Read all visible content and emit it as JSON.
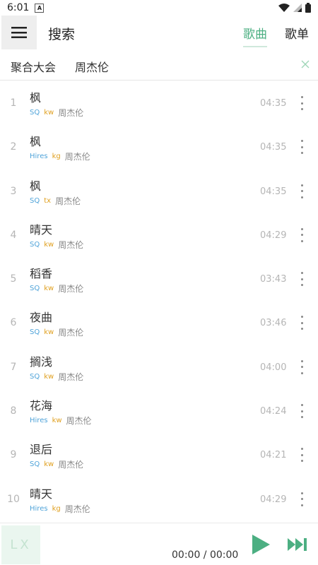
{
  "status_bar": {
    "time": "6:01",
    "notif_icon_letter": "A"
  },
  "header": {
    "title": "搜索",
    "tabs": [
      {
        "label": "歌曲",
        "active": true
      },
      {
        "label": "歌单",
        "active": false
      }
    ]
  },
  "search": {
    "source": "聚合大会",
    "query": "周杰伦"
  },
  "songs": [
    {
      "num": "1",
      "title": "枫",
      "quality": "SQ",
      "source": "kw",
      "artist": "周杰伦",
      "duration": "04:35"
    },
    {
      "num": "2",
      "title": "枫",
      "quality": "Hires",
      "source": "kg",
      "artist": "周杰伦",
      "duration": "04:35"
    },
    {
      "num": "3",
      "title": "枫",
      "quality": "SQ",
      "source": "tx",
      "artist": "周杰伦",
      "duration": "04:35"
    },
    {
      "num": "4",
      "title": "晴天",
      "quality": "SQ",
      "source": "kw",
      "artist": "周杰伦",
      "duration": "04:29"
    },
    {
      "num": "5",
      "title": "稻香",
      "quality": "SQ",
      "source": "kw",
      "artist": "周杰伦",
      "duration": "03:43"
    },
    {
      "num": "6",
      "title": "夜曲",
      "quality": "SQ",
      "source": "kw",
      "artist": "周杰伦",
      "duration": "03:46"
    },
    {
      "num": "7",
      "title": "搁浅",
      "quality": "SQ",
      "source": "kw",
      "artist": "周杰伦",
      "duration": "04:00"
    },
    {
      "num": "8",
      "title": "花海",
      "quality": "Hires",
      "source": "kw",
      "artist": "周杰伦",
      "duration": "04:24"
    },
    {
      "num": "9",
      "title": "退后",
      "quality": "SQ",
      "source": "kw",
      "artist": "周杰伦",
      "duration": "04:21"
    },
    {
      "num": "10",
      "title": "晴天",
      "quality": "Hires",
      "source": "kg",
      "artist": "周杰伦",
      "duration": "04:29"
    }
  ],
  "player": {
    "logo": "LX",
    "time": "00:00 / 00:00"
  },
  "colors": {
    "accent": "#4caf82",
    "quality": "#4fa3d9",
    "source": "#e0a020"
  },
  "icons": {
    "menu": "hamburger-menu-icon",
    "clear": "close-icon",
    "more": "more-vertical-icon",
    "play": "play-icon",
    "next": "skip-next-icon",
    "wifi": "wifi-icon",
    "signal": "signal-icon",
    "battery": "battery-icon"
  }
}
